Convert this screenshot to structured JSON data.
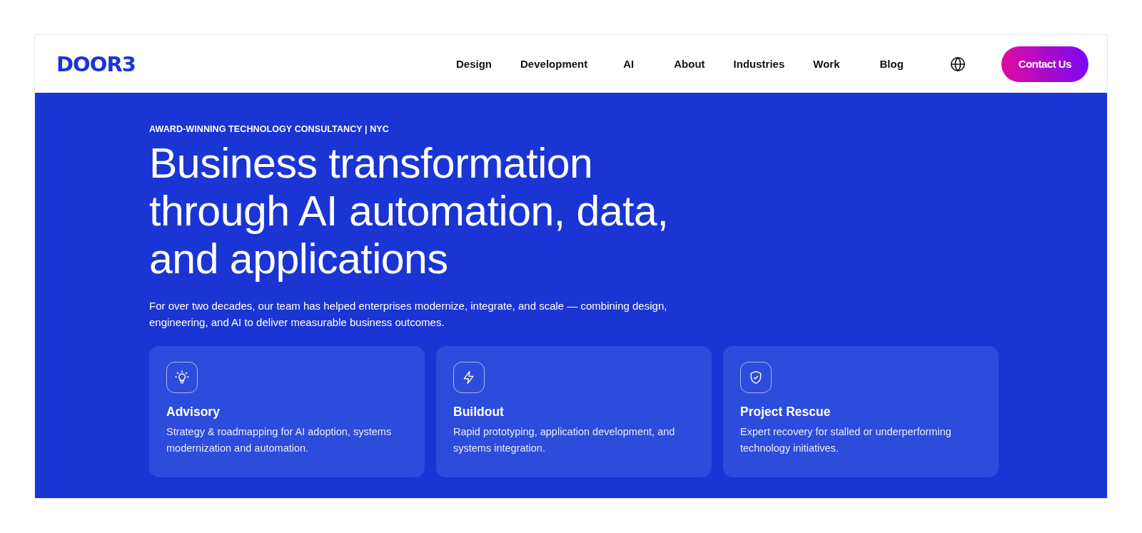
{
  "header": {
    "logo": "DOOR3",
    "nav": [
      "Design",
      "Development",
      "AI",
      "About",
      "Industries",
      "Work",
      "Blog"
    ],
    "cta": "Contact Us"
  },
  "hero": {
    "eyebrow": "AWARD-WINNING TECHNOLOGY CONSULTANCY | NYC",
    "title_lines": [
      "Business transformation",
      "through AI automation, data,",
      "and applications"
    ],
    "intro": "For over two decades, our team has helped enterprises modernize, integrate, and scale — combining design, engineering, and AI to deliver measurable business outcomes.",
    "cards": [
      {
        "title": "Advisory",
        "text": "Strategy & roadmapping for AI adoption, systems modernization and automation."
      },
      {
        "title": "Buildout",
        "text": "Rapid prototyping, application development, and systems integration."
      },
      {
        "title": "Project Rescue",
        "text": "Expert recovery for stalled or underperforming technology initiatives."
      }
    ]
  }
}
